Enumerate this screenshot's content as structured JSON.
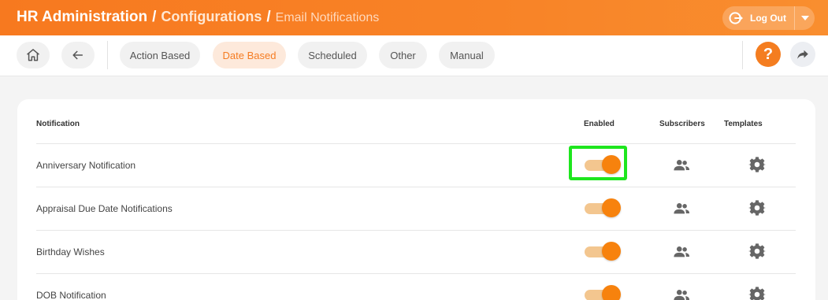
{
  "header": {
    "breadcrumb": [
      "HR Administration",
      "Configurations",
      "Email Notifications"
    ],
    "separator": "/",
    "logout_label": "Log Out"
  },
  "toolbar": {
    "tabs": [
      {
        "label": "Action Based",
        "active": false
      },
      {
        "label": "Date Based",
        "active": true
      },
      {
        "label": "Scheduled",
        "active": false
      },
      {
        "label": "Other",
        "active": false
      },
      {
        "label": "Manual",
        "active": false
      }
    ],
    "help_label": "?"
  },
  "table": {
    "columns": [
      "Notification",
      "Enabled",
      "Subscribers",
      "Templates"
    ],
    "rows": [
      {
        "name": "Anniversary Notification",
        "enabled": true
      },
      {
        "name": "Appraisal Due Date Notifications",
        "enabled": true
      },
      {
        "name": "Birthday Wishes",
        "enabled": true
      },
      {
        "name": "DOB Notification",
        "enabled": true
      }
    ]
  },
  "colors": {
    "accent": "#f57c22",
    "highlight": "#1ee61e",
    "toggle_track": "#f3c68f",
    "toggle_knob": "#f7820d"
  },
  "icons": [
    "home-icon",
    "back-arrow-icon",
    "logout-icon",
    "chevron-down-icon",
    "help-icon",
    "share-icon",
    "subscribers-icon",
    "gear-icon"
  ]
}
